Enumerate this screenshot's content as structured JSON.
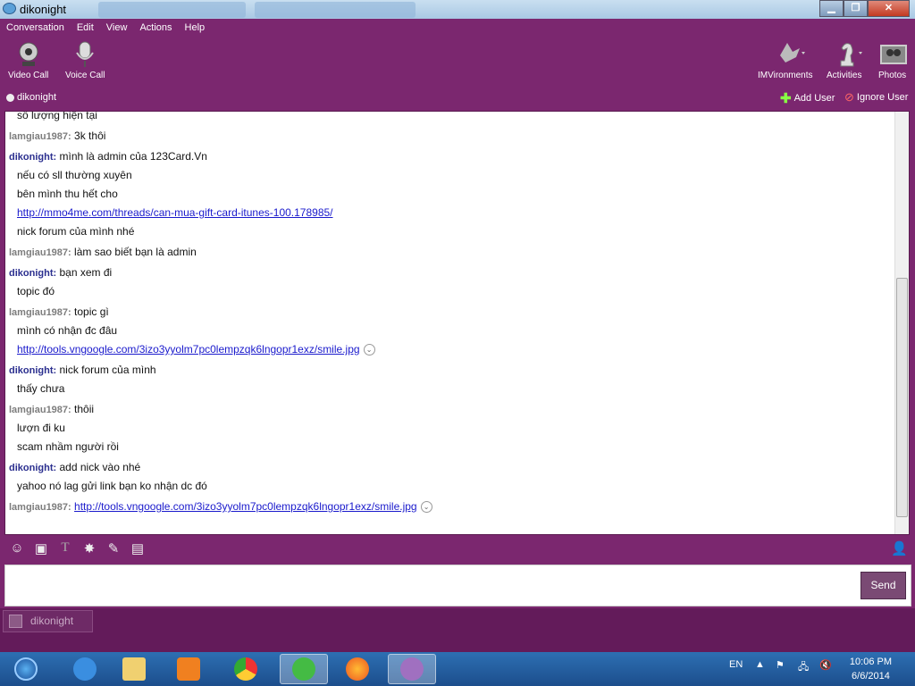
{
  "window": {
    "title": "dikonight"
  },
  "menu": [
    "Conversation",
    "Edit",
    "View",
    "Actions",
    "Help"
  ],
  "toolbar": {
    "video_call": "Video Call",
    "voice_call": "Voice Call",
    "imvironments": "IMVironments",
    "activities": "Activities",
    "photos": "Photos"
  },
  "contact": {
    "name": "dikonight",
    "add_user": "Add User",
    "ignore_user": "Ignore User"
  },
  "messages": [
    {
      "sender": "",
      "lines": [
        {
          "text": "số lượng hiện tại"
        }
      ]
    },
    {
      "sender": "lamgiau1987:",
      "me": false,
      "lines": [
        {
          "text": "3k thôi"
        }
      ]
    },
    {
      "sender": "dikonight:",
      "me": true,
      "lines": [
        {
          "text": "mình là admin của 123Card.Vn"
        },
        {
          "text": "nếu có sll thường xuyên"
        },
        {
          "text": "bên mình thu hết cho"
        },
        {
          "text": "http://mmo4me.com/threads/can-mua-gift-card-itunes-100.178985/",
          "link": true
        },
        {
          "text": "nick forum của mình nhé"
        }
      ]
    },
    {
      "sender": "lamgiau1987:",
      "me": false,
      "lines": [
        {
          "text": "làm sao biết bạn là admin"
        }
      ]
    },
    {
      "sender": "dikonight:",
      "me": true,
      "lines": [
        {
          "text": "bạn xem đi"
        },
        {
          "text": "topic đó"
        }
      ]
    },
    {
      "sender": "lamgiau1987:",
      "me": false,
      "lines": [
        {
          "text": "topic gì"
        },
        {
          "text": "mình có nhận đc đâu"
        },
        {
          "text": "http://tools.vngoogle.com/3izo3yyolm7pc0lempzqk6lngopr1exz/smile.jpg",
          "link": true,
          "expand": true
        }
      ]
    },
    {
      "sender": "dikonight:",
      "me": true,
      "lines": [
        {
          "text": "nick forum của mình"
        },
        {
          "text": "thấy chưa"
        }
      ]
    },
    {
      "sender": "lamgiau1987:",
      "me": false,
      "lines": [
        {
          "text": "thôii"
        },
        {
          "text": "lượn đi ku"
        },
        {
          "text": "scam nhầm người rồi"
        }
      ]
    },
    {
      "sender": "dikonight:",
      "me": true,
      "lines": [
        {
          "text": "add nick vào nhé"
        },
        {
          "text": "yahoo nó lag gửi link bạn ko nhận dc đó"
        }
      ]
    },
    {
      "sender": "lamgiau1987:",
      "me": false,
      "lines": [
        {
          "text": "http://tools.vngoogle.com/3izo3yyolm7pc0lempzqk6lngopr1exz/smile.jpg",
          "link": true,
          "expand": true
        }
      ]
    }
  ],
  "compose": {
    "value": "",
    "send": "Send"
  },
  "tabs": [
    {
      "label": "dikonight"
    }
  ],
  "taskbar": {
    "language": "EN",
    "time": "10:06 PM",
    "date": "6/6/2014"
  },
  "colors": {
    "purple": "#7b276f",
    "dark_purple": "#631b5a",
    "sender_me": "#2b2f8f",
    "sender_them": "#7d7d7d"
  }
}
